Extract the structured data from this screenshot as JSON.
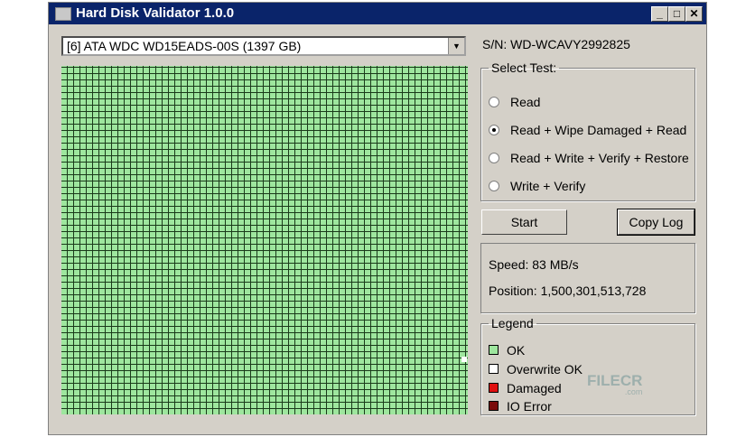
{
  "window": {
    "title": "Hard Disk Validator 1.0.0"
  },
  "drive_select": {
    "value": "[6] ATA WDC WD15EADS-00S (1397 GB)"
  },
  "serial": "S/N: WD-WCAVY2992825",
  "select_test": {
    "label": "Select Test:",
    "options": [
      {
        "label": "Read",
        "selected": false
      },
      {
        "label": "Read + Wipe Damaged + Read",
        "selected": true
      },
      {
        "label": "Read + Write + Verify + Restore",
        "selected": false
      },
      {
        "label": "Write + Verify",
        "selected": false
      }
    ]
  },
  "buttons": {
    "start": "Start",
    "copy_log": "Copy Log"
  },
  "status": {
    "speed": "Speed: 83 MB/s",
    "position": "Position: 1,500,301,513,728"
  },
  "legend": {
    "label": "Legend",
    "items": [
      {
        "label": "OK",
        "color": "#9ee69e"
      },
      {
        "label": "Overwrite OK",
        "color": "#ffffff"
      },
      {
        "label": "Damaged",
        "color": "#e01010"
      },
      {
        "label": "IO Error",
        "color": "#7a0a0a"
      }
    ]
  },
  "watermark": {
    "text": "FILECR",
    ".com": ".com"
  }
}
